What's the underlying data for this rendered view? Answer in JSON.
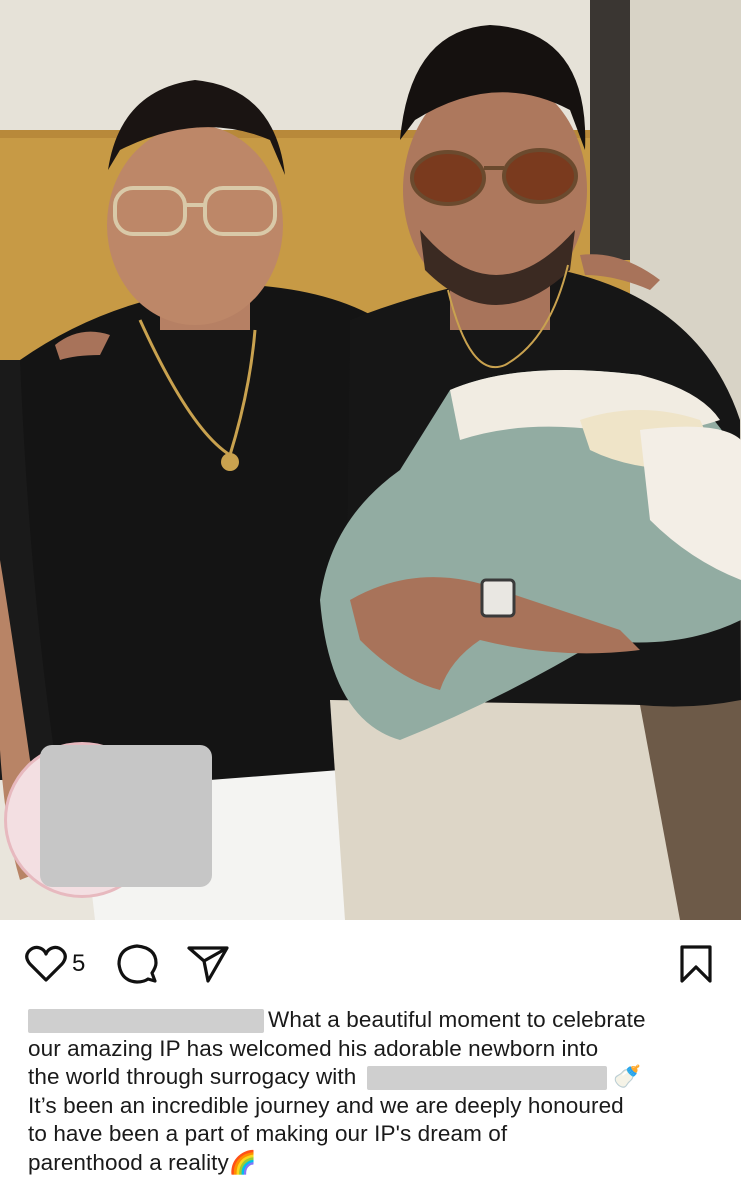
{
  "post": {
    "image_alt": "Two men in black t-shirts posing together, one holding a newborn wrapped in a sage knit blanket",
    "likes": "5",
    "caption_lines": [
      "What a beautiful moment to celebrate",
      "our amazing IP has welcomed his adorable newborn into",
      "the world through surrogacy with",
      "It’s been an incredible journey and we are deeply honoured",
      "to have been a part of making our IP's dream of",
      "parenthood a reality"
    ],
    "emoji_bottle": "🍼",
    "emoji_rainbow": "🌈"
  },
  "icons": {
    "like": "heart-icon",
    "comment": "comment-icon",
    "share": "share-icon",
    "save": "bookmark-icon"
  },
  "colors": {
    "text": "#1a1a1a",
    "redaction": "#c9c9c9",
    "story_ring": "#e7b9bf"
  }
}
